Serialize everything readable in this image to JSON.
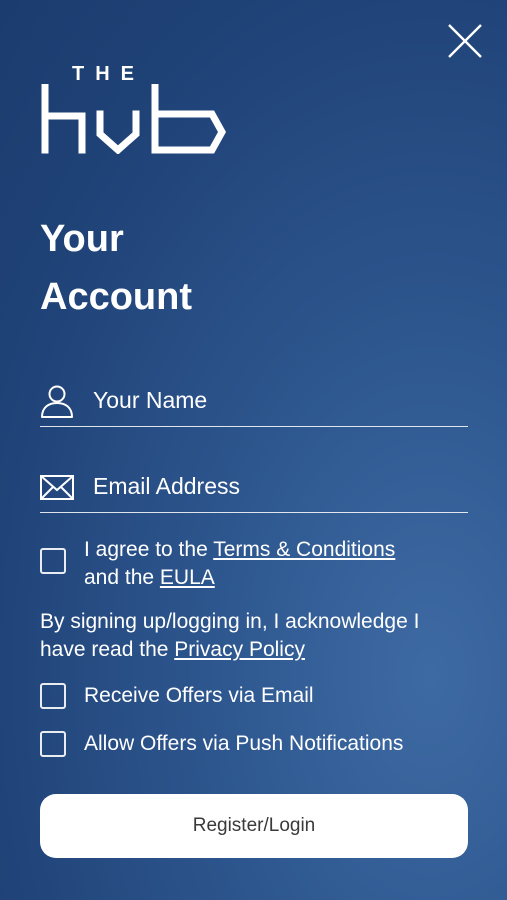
{
  "logo": {
    "top_text": "THE",
    "main_text": "hub"
  },
  "close": {
    "icon": "close-icon"
  },
  "title": {
    "line1": "Your",
    "line2": "Account"
  },
  "form": {
    "name": {
      "placeholder": "Your Name",
      "value": "",
      "icon": "user-icon"
    },
    "email": {
      "placeholder": "Email Address",
      "value": "",
      "icon": "mail-icon"
    }
  },
  "agree": {
    "prefix": "I agree to the ",
    "terms_link": "Terms & Conditions",
    "middle": "and the ",
    "eula_link": "EULA",
    "checked": false
  },
  "privacy": {
    "line1": "By signing up/logging in, I acknowledge I",
    "line2_prefix": "have read the ",
    "link": "Privacy Policy"
  },
  "offers": [
    {
      "label": "Receive Offers via Email",
      "checked": false
    },
    {
      "label": "Allow Offers via Push Notifications",
      "checked": false
    }
  ],
  "submit": {
    "label": "Register/Login"
  },
  "colors": {
    "background": "#234a80",
    "button": "#ffffff",
    "button_text": "#3a3a3a"
  }
}
